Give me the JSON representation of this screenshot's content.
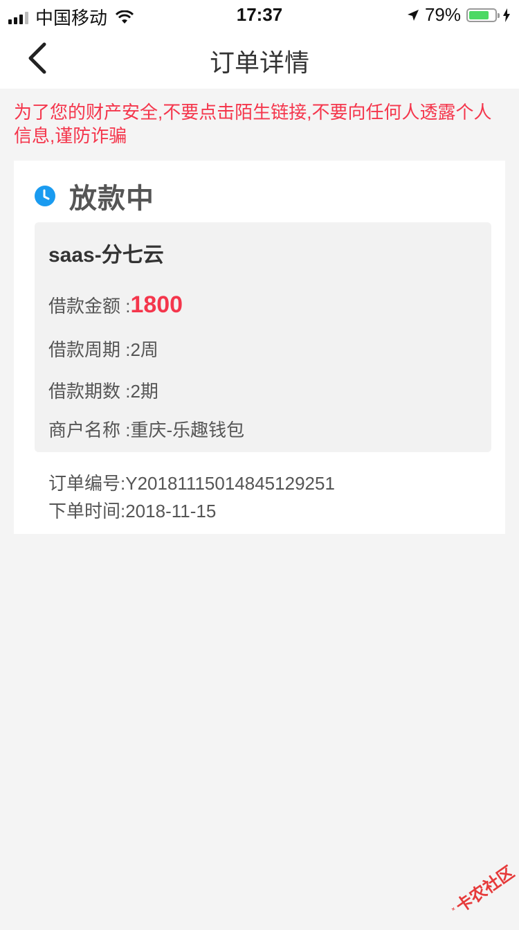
{
  "status_bar": {
    "carrier": "中国移动",
    "time": "17:37",
    "battery_percent": "79%",
    "battery_level": 0.79,
    "colors": {
      "battery": "#4cd964"
    }
  },
  "nav": {
    "title": "订单详情",
    "back_icon": "chevron-left-icon"
  },
  "warning": {
    "text": "为了您的财产安全,不要点击陌生链接,不要向任何人透露个人信息,谨防诈骗",
    "color": "#f4364c"
  },
  "order_card": {
    "status_icon": "clock-icon",
    "status_text": "放款中",
    "product_name": "saas-分七云",
    "fields": [
      {
        "label": "借款金额 : ",
        "value": "1800"
      },
      {
        "label": "借款周期 : ",
        "value": "2周"
      },
      {
        "label": "借款期数 : ",
        "value": "2期"
      },
      {
        "label": "商户名称 : ",
        "value": "重庆-乐趣钱包"
      }
    ],
    "order_number": "订单编号:Y20181115014845129251",
    "order_time": "下单时间:2018-11-15",
    "accent_color": "#f4364c"
  },
  "watermark": {
    "text": "卡农社区"
  }
}
